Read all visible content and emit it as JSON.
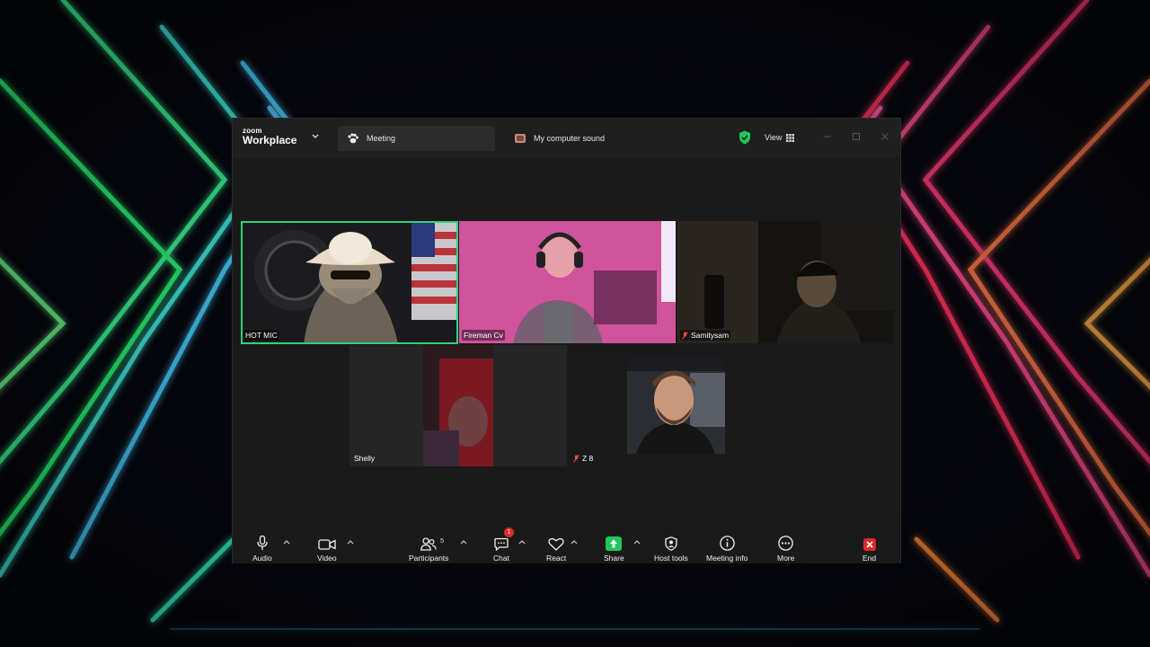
{
  "app": {
    "brand_top": "zoom",
    "brand_bottom": "Workplace"
  },
  "tabs": [
    {
      "label": "Meeting",
      "icon": "paw-icon"
    },
    {
      "label": "My computer sound",
      "icon": "app-icon"
    }
  ],
  "titlebar": {
    "view_label": "View"
  },
  "participants": [
    {
      "name": "HOT MIC",
      "muted": false,
      "active_speaker": true
    },
    {
      "name": "Fireman Cv",
      "muted": false
    },
    {
      "name": "Samitysam",
      "muted": true
    },
    {
      "name": "Shelly",
      "muted": false
    },
    {
      "name": "Z 8",
      "muted": true
    },
    {
      "name": "",
      "muted": false
    }
  ],
  "toolbar": {
    "audio": "Audio",
    "video": "Video",
    "participants": "Participants",
    "participants_count": "5",
    "chat": "Chat",
    "chat_badge": "1",
    "react": "React",
    "share": "Share",
    "host_tools": "Host tools",
    "meeting_info": "Meeting info",
    "more": "More",
    "end": "End"
  },
  "colors": {
    "active_speaker": "#2fd27c",
    "share_green": "#22c55e",
    "end_red": "#e02828",
    "badge_red": "#e02828"
  }
}
